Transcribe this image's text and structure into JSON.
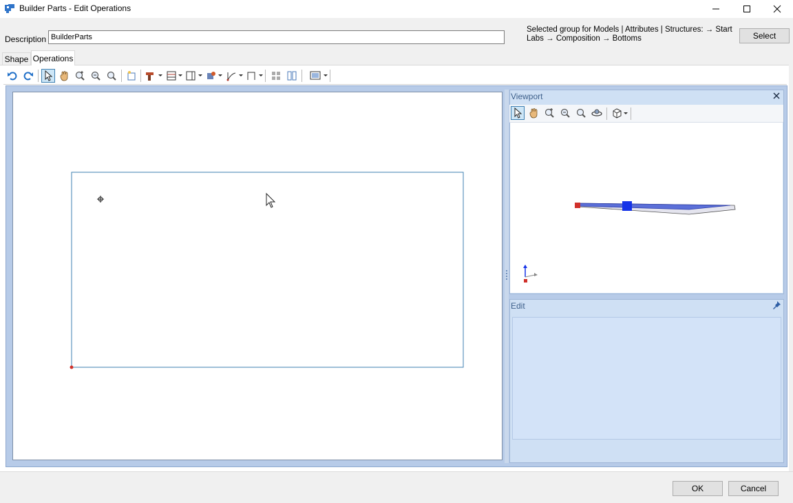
{
  "window": {
    "title": "Builder Parts - Edit Operations",
    "minimize_icon": "minimize-icon",
    "maximize_icon": "maximize-icon",
    "close_icon": "close-icon"
  },
  "description": {
    "label": "Description",
    "value": "BuilderParts"
  },
  "selected_group": {
    "line1": "Selected group for Models | Attributes | Structures:  → Start",
    "line2": "Labs → Composition → Bottoms"
  },
  "select_button": "Select",
  "tabs": [
    {
      "label": "Shape",
      "active": false
    },
    {
      "label": "Operations",
      "active": true
    }
  ],
  "toolbar": {
    "items": [
      "undo-icon",
      "redo-icon",
      "select-pointer-icon",
      "pan-hand-icon",
      "zoom-in-icon",
      "zoom-out-icon",
      "zoom-fit-icon",
      "new-point-icon",
      "drill-icon",
      "rows-icon",
      "columns-icon",
      "tools-icon",
      "curve-icon",
      "bracket-icon",
      "grid-icon",
      "split-icon",
      "view-options-icon"
    ]
  },
  "viewport": {
    "title": "Viewport",
    "toolbar": [
      "select-pointer-icon",
      "pan-hand-icon",
      "zoom-in-icon",
      "zoom-out-icon",
      "zoom-fit-icon",
      "rotate-icon",
      "cube-view-icon"
    ]
  },
  "edit": {
    "title": "Edit"
  },
  "buttons": {
    "ok": "OK",
    "cancel": "Cancel"
  },
  "colors": {
    "panel_blue": "#b7cbe8",
    "edit_area": "#d3e3f8",
    "outline": "#3c7fb1",
    "marker_red": "#d0302a",
    "marker_blue": "#1533e8"
  }
}
